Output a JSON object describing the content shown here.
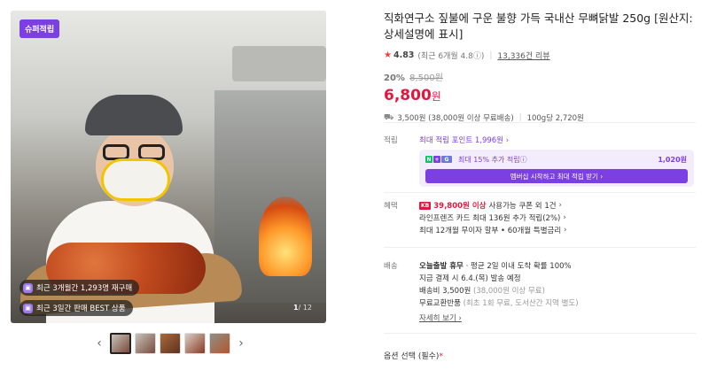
{
  "gallery": {
    "badge": "슈퍼적립",
    "pill_1": "최근 3개월간 1,293명 재구매",
    "pill_2": "최근 3일간 판매 BEST 상품",
    "counter_current": "1",
    "counter_total": "/ 12",
    "prev_arrow": "‹",
    "next_arrow": "›"
  },
  "product": {
    "title": "직화연구소 짚불에 구운 불향 가득 국내산 무뼈닭발 250g [원산지: 상세설명에 표시]",
    "rating": "4.83",
    "rating_sub": "(최근 6개월 4.8ⓘ)",
    "reviews": "13,336건 리뷰",
    "discount": "20%",
    "original_price": "8,500원",
    "price_value": "6,800",
    "price_unit": "원",
    "shipping": "3,500원 (38,000원 이상 무료배송)",
    "unit_price": "100g당 2,720원"
  },
  "points": {
    "label": "적립",
    "link": "최대 적립 포인트 1,996원 ›",
    "extra": "최대 15% 추가 적립ⓘ",
    "amount": "1,020원",
    "button": "멤버십 시작하고 최대 적립 받기 ›"
  },
  "benefits": {
    "label": "혜택",
    "item_1_logo": "KB",
    "item_1_red": "39,800원 이상",
    "item_1_rest": "사용가능 쿠폰 외 1건",
    "item_2": "라인프렌즈 카드 최대 136원 추가 적립(2%)",
    "item_3": "최대 12개월 무이자 할부 • 60개월 특별금리"
  },
  "delivery": {
    "label": "배송",
    "line_1_bold": "오늘출발 휴무",
    "line_1_rest": "· 평균 2일 이내 도착 확률 100%",
    "line_2": "지금 결제 시 6.4.(목) 발송 예정",
    "line_3": "배송비 3,500원",
    "line_3_gray": "(38,000원 이상 무료)",
    "line_4": "무료교환반품",
    "line_4_gray": "(최초 1회 무료, 도서산간 지역 별도)",
    "more": "자세히 보기 ›"
  },
  "option": {
    "label": "옵션 선택 (필수)",
    "required_mark": "*"
  },
  "colors": {
    "accent": "#7b3fe4",
    "price": "#e3173e"
  }
}
